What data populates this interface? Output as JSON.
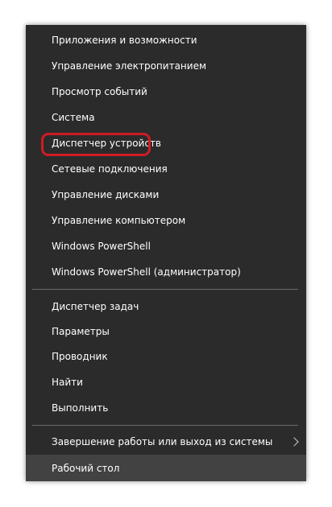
{
  "menu": {
    "group1": [
      {
        "label": "Приложения и возможности"
      },
      {
        "label": "Управление электропитанием"
      },
      {
        "label": "Просмотр событий"
      },
      {
        "label": "Система"
      },
      {
        "label": "Диспетчер устройств"
      },
      {
        "label": "Сетевые подключения"
      },
      {
        "label": "Управление дисками"
      },
      {
        "label": "Управление компьютером"
      },
      {
        "label": "Windows PowerShell"
      },
      {
        "label": "Windows PowerShell (администратор)"
      }
    ],
    "group2": [
      {
        "label": "Диспетчер задач"
      },
      {
        "label": "Параметры"
      },
      {
        "label": "Проводник"
      },
      {
        "label": "Найти"
      },
      {
        "label": "Выполнить"
      }
    ],
    "group3": [
      {
        "label": "Завершение работы или выход из системы",
        "submenu_icon": "chevron-right-icon"
      },
      {
        "label": "Рабочий стол",
        "state": "hover"
      }
    ]
  },
  "colors": {
    "menu_background": "#2b2b2b",
    "hover_background": "#424242",
    "text": "#ffffff",
    "separator": "#6b6b6b",
    "highlight_annotation": "#d01b24"
  }
}
